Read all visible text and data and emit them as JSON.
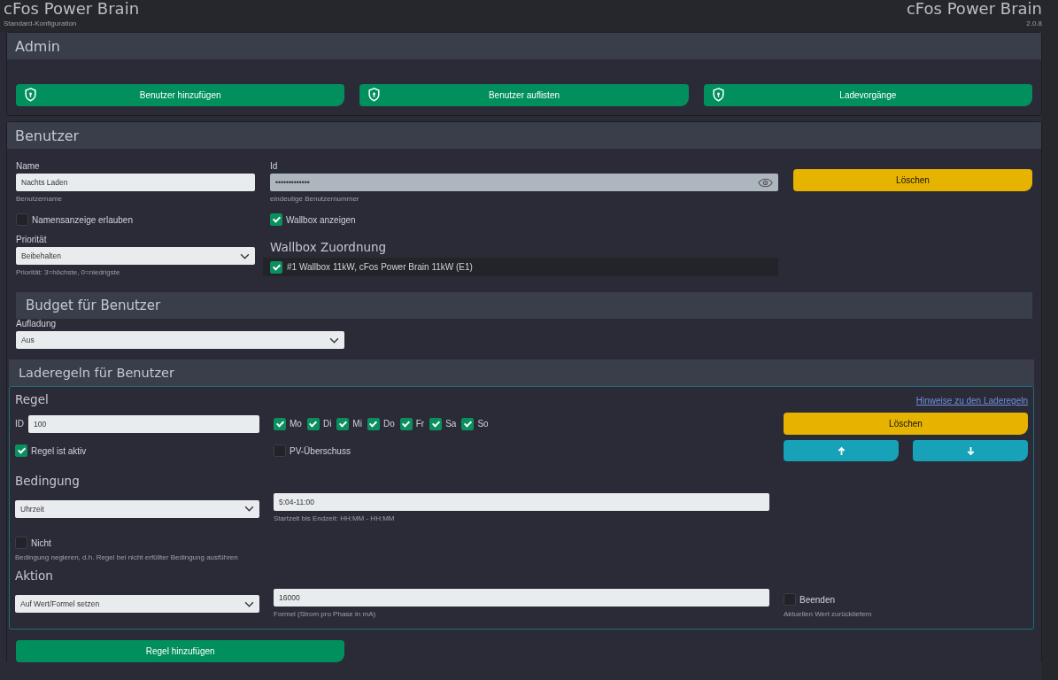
{
  "header": {
    "title": "cFos Power Brain",
    "subtitle": "Standard-Konfiguration",
    "title_right": "cFos Power Brain",
    "version": "2.0.8"
  },
  "admin": {
    "title": "Admin",
    "buttons": [
      {
        "label": "Benutzer hinzufügen"
      },
      {
        "label": "Benutzer auflisten"
      },
      {
        "label": "Ladevorgänge"
      }
    ]
  },
  "user": {
    "title": "Benutzer",
    "name": {
      "label": "Name",
      "value": "Nachts Laden",
      "help": "Benutzername"
    },
    "id": {
      "label": "Id",
      "value": "•••••••••••••",
      "help": "eindeutige Benutzernummer",
      "disabled": true
    },
    "delete_button": "Löschen",
    "show_name": {
      "label": "Namensanzeige erlauben",
      "checked": false
    },
    "show_wallbox": {
      "label": "Wallbox anzeigen",
      "checked": true
    },
    "priority": {
      "label": "Priorität",
      "value": "Beibehalten",
      "help": "Priorität: 3=höchste, 0=niedrigste"
    },
    "wallbox_assignment": {
      "title": "Wallbox Zuordnung",
      "items": [
        {
          "label": "#1 Wallbox 11kW, cFos Power Brain 11kW (E1)",
          "checked": true
        }
      ]
    },
    "budget": {
      "title": "Budget für Benutzer",
      "charging": {
        "label": "Aufladung",
        "value": "Aus"
      }
    }
  },
  "rules": {
    "title": "Laderegeln für Benutzer",
    "rule": {
      "title": "Regel",
      "hint_link": "Hinweise zu den Laderegeln",
      "id_label": "ID",
      "id_value": "100",
      "days": [
        {
          "label": "Mo",
          "checked": true
        },
        {
          "label": "Di",
          "checked": true
        },
        {
          "label": "Mi",
          "checked": true
        },
        {
          "label": "Do",
          "checked": true
        },
        {
          "label": "Fr",
          "checked": true
        },
        {
          "label": "Sa",
          "checked": true
        },
        {
          "label": "So",
          "checked": true
        }
      ],
      "active": {
        "label": "Regel ist aktiv",
        "checked": true
      },
      "pv_surplus": {
        "label": "PV-Überschuss",
        "checked": false
      },
      "delete_button": "Löschen",
      "condition": {
        "title": "Bedingung",
        "select": "Uhrzeit",
        "value": "5:04-11:00",
        "help": "Startzeit bis Endzeit: HH:MM - HH:MM"
      },
      "negate": {
        "label": "Nicht",
        "checked": false,
        "help": "Bedingung negieren, d.h. Regel bei nicht erfüllter Bedingung ausführen"
      },
      "action": {
        "title": "Aktion",
        "select": "Auf Wert/Formel setzen",
        "value": "16000",
        "help": "Formel (Strom pro Phase in mA)"
      },
      "end": {
        "label": "Beenden",
        "checked": false,
        "help": "Aktuellen Wert zurückliefern"
      }
    },
    "add_button": "Regel hinzufügen"
  }
}
